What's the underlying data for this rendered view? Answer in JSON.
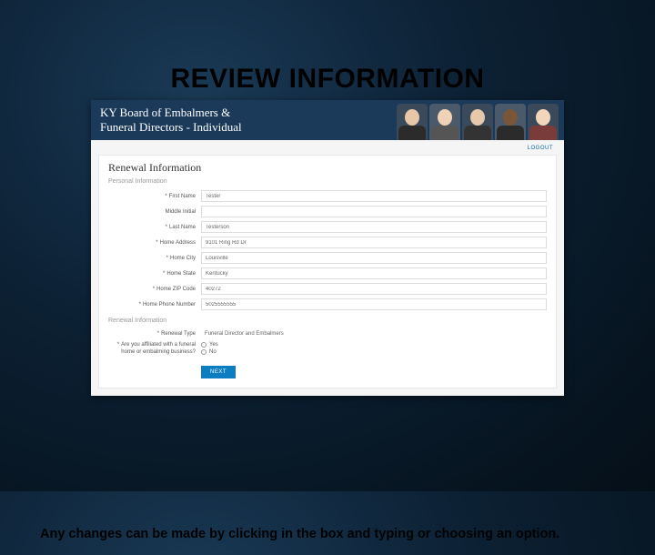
{
  "slide": {
    "title": "REVIEW INFORMATION",
    "caption": "Any changes can be made by clicking in the box and typing or choosing an option."
  },
  "app": {
    "header_line1": "KY Board of Embalmers &",
    "header_line2": "Funeral Directors - Individual",
    "logout": "LOGOUT",
    "card_title": "Renewal Information",
    "section_personal": "Personal Information",
    "section_renewal": "Renewal Information",
    "next": "NEXT"
  },
  "fields": {
    "first_name": {
      "label": "First Name",
      "value": "Tester",
      "required": true
    },
    "middle_initial": {
      "label": "Middle Initial",
      "value": "",
      "required": false
    },
    "last_name": {
      "label": "Last Name",
      "value": "Testerson",
      "required": true
    },
    "home_address": {
      "label": "Home Address",
      "value": "9101 Ring Rd Dr",
      "required": true
    },
    "home_city": {
      "label": "Home City",
      "value": "Louisville",
      "required": true
    },
    "home_state": {
      "label": "Home State",
      "value": "Kentucky",
      "required": true
    },
    "home_zip": {
      "label": "Home ZIP Code",
      "value": "40272",
      "required": true
    },
    "home_phone": {
      "label": "Home Phone Number",
      "value": "5025555555",
      "required": true
    },
    "renewal_type": {
      "label": "Renewal Type",
      "value": "Funeral Director and Embalmers",
      "required": true
    },
    "affiliated": {
      "label": "Are you affiliated with a funeral home or embalming business?",
      "required": true,
      "options": {
        "yes": "Yes",
        "no": "No"
      }
    }
  }
}
